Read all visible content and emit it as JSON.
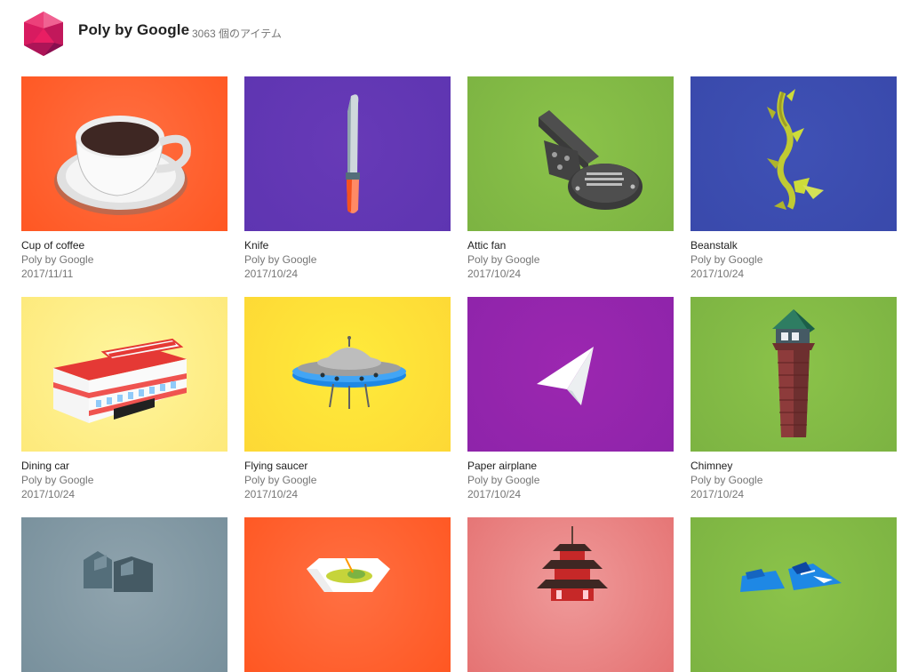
{
  "header": {
    "title": "Poly by Google",
    "count": "3063 個のアイテム",
    "logo_icon": "poly-logo-icon",
    "logo_color": "#e91e63"
  },
  "items": [
    {
      "title": "Cup of coffee",
      "author": "Poly by Google",
      "date": "2017/11/11",
      "bg": [
        "#ff7043",
        "#ff5722"
      ],
      "icon": "coffee-cup-icon"
    },
    {
      "title": "Knife",
      "author": "Poly by Google",
      "date": "2017/10/24",
      "bg": [
        "#673ab7",
        "#5e35b1"
      ],
      "icon": "knife-icon"
    },
    {
      "title": "Attic fan",
      "author": "Poly by Google",
      "date": "2017/10/24",
      "bg": [
        "#8bc34a",
        "#7cb342"
      ],
      "icon": "attic-fan-icon"
    },
    {
      "title": "Beanstalk",
      "author": "Poly by Google",
      "date": "2017/10/24",
      "bg": [
        "#3f51b5",
        "#3949ab"
      ],
      "icon": "beanstalk-icon"
    },
    {
      "title": "Dining car",
      "author": "Poly by Google",
      "date": "2017/10/24",
      "bg": [
        "#fff59d",
        "#fde97a"
      ],
      "icon": "dining-car-icon"
    },
    {
      "title": "Flying saucer",
      "author": "Poly by Google",
      "date": "2017/10/24",
      "bg": [
        "#ffeb3b",
        "#fdd835"
      ],
      "icon": "flying-saucer-icon"
    },
    {
      "title": "Paper airplane",
      "author": "Poly by Google",
      "date": "2017/10/24",
      "bg": [
        "#9c27b0",
        "#8e24aa"
      ],
      "icon": "paper-airplane-icon"
    },
    {
      "title": "Chimney",
      "author": "Poly by Google",
      "date": "2017/10/24",
      "bg": [
        "#8bc34a",
        "#7cb342"
      ],
      "icon": "chimney-icon"
    },
    {
      "title": "",
      "author": "",
      "date": "",
      "bg": [
        "#90a4ae",
        "#78909c"
      ],
      "icon": "gray-object-icon"
    },
    {
      "title": "",
      "author": "",
      "date": "",
      "bg": [
        "#ff7043",
        "#ff5722"
      ],
      "icon": "bowl-icon"
    },
    {
      "title": "",
      "author": "",
      "date": "",
      "bg": [
        "#ef9a9a",
        "#e57373"
      ],
      "icon": "pagoda-icon"
    },
    {
      "title": "",
      "author": "",
      "date": "",
      "bg": [
        "#8bc34a",
        "#7cb342"
      ],
      "icon": "sneakers-icon"
    }
  ]
}
